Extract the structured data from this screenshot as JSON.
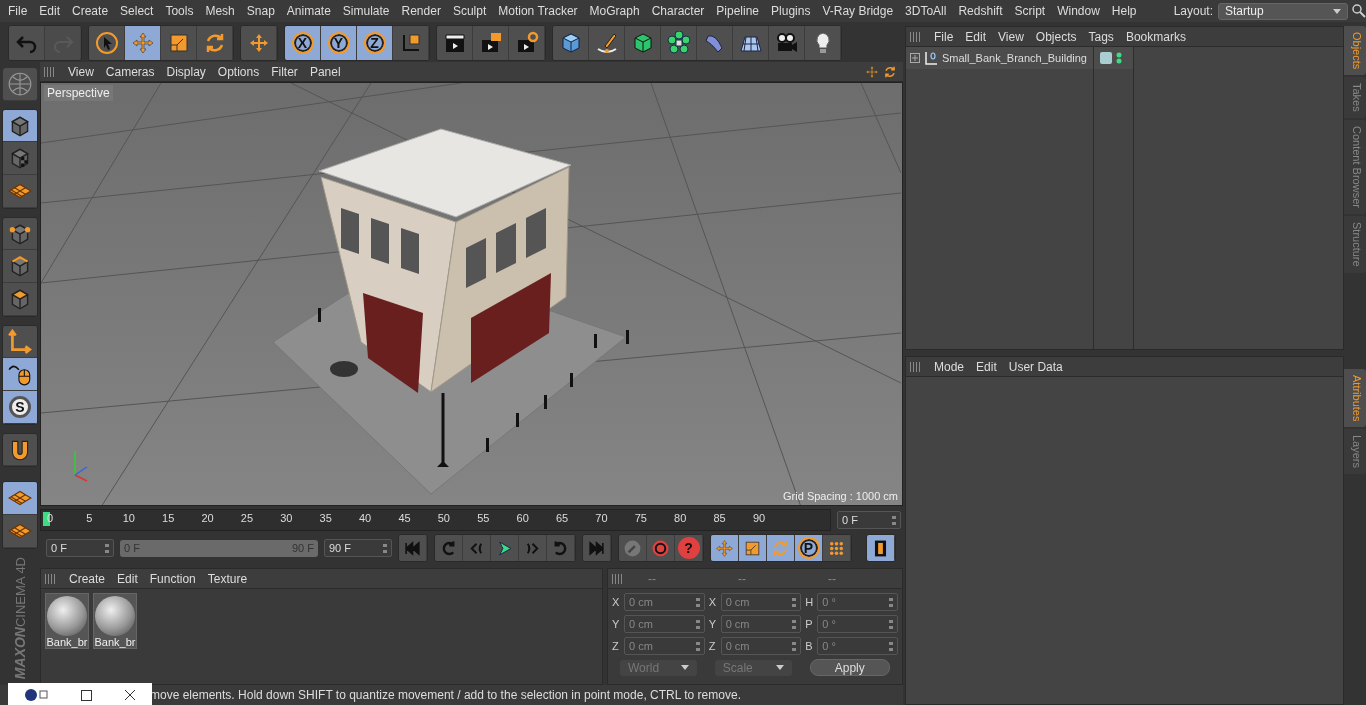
{
  "menu": [
    "File",
    "Edit",
    "Create",
    "Select",
    "Tools",
    "Mesh",
    "Snap",
    "Animate",
    "Simulate",
    "Render",
    "Sculpt",
    "Motion Tracker",
    "MoGraph",
    "Character",
    "Pipeline",
    "Plugins",
    "V-Ray Bridge",
    "3DToAll",
    "Redshift",
    "Script",
    "Window",
    "Help"
  ],
  "layout": {
    "label": "Layout:",
    "value": "Startup"
  },
  "toolbar": [
    [
      {
        "kind": "undo",
        "selected": false,
        "disabled": false
      },
      {
        "kind": "redo",
        "selected": false,
        "disabled": true
      }
    ],
    [
      {
        "kind": "select",
        "selected": false,
        "disabled": false
      },
      {
        "kind": "move",
        "selected": true,
        "disabled": false
      },
      {
        "kind": "scale",
        "selected": false,
        "disabled": false
      },
      {
        "kind": "rotate",
        "selected": false,
        "disabled": false
      }
    ],
    [
      {
        "kind": "transform",
        "selected": false,
        "disabled": false
      }
    ],
    [
      {
        "kind": "axis-x",
        "label": "X",
        "selected": true,
        "disabled": false
      },
      {
        "kind": "axis-y",
        "label": "Y",
        "selected": true,
        "disabled": false
      },
      {
        "kind": "axis-z",
        "label": "Z",
        "selected": true,
        "disabled": false
      },
      {
        "kind": "coord",
        "selected": false,
        "disabled": false
      }
    ],
    [
      {
        "kind": "render-view",
        "selected": false,
        "disabled": false
      },
      {
        "kind": "render-picture",
        "selected": false,
        "disabled": false
      },
      {
        "kind": "render-settings",
        "selected": false,
        "disabled": false
      }
    ],
    [
      {
        "kind": "cube",
        "selected": false,
        "disabled": false
      },
      {
        "kind": "pen",
        "selected": false,
        "disabled": false
      },
      {
        "kind": "subdivide",
        "selected": false,
        "disabled": false
      },
      {
        "kind": "cloner",
        "selected": false,
        "disabled": false
      },
      {
        "kind": "deformer",
        "selected": false,
        "disabled": false
      },
      {
        "kind": "floor",
        "selected": false,
        "disabled": false
      },
      {
        "kind": "camera",
        "selected": false,
        "disabled": false
      },
      {
        "kind": "light",
        "selected": false,
        "disabled": false
      }
    ]
  ],
  "sidebar": [
    [
      {
        "kind": "model",
        "selected": true
      },
      {
        "kind": "texture",
        "selected": false
      },
      {
        "kind": "workplane",
        "selected": false
      }
    ],
    [
      {
        "kind": "points",
        "selected": false
      },
      {
        "kind": "edges",
        "selected": false
      },
      {
        "kind": "polygons",
        "selected": false
      }
    ],
    [
      {
        "kind": "axis-tool",
        "selected": false
      },
      {
        "kind": "tweak",
        "selected": true
      },
      {
        "kind": "solo",
        "label": "S",
        "selected": true
      }
    ],
    [
      {
        "kind": "magnet",
        "selected": false
      }
    ]
  ],
  "viewport": {
    "menu": [
      "View",
      "Cameras",
      "Display",
      "Options",
      "Filter",
      "Panel"
    ],
    "label": "Perspective",
    "grid_spacing": "Grid Spacing : 1000 cm"
  },
  "timeline": {
    "ticks": [
      "0",
      "5",
      "10",
      "15",
      "20",
      "25",
      "30",
      "35",
      "40",
      "45",
      "50",
      "55",
      "60",
      "65",
      "70",
      "75",
      "80",
      "85",
      "90"
    ],
    "level": 0,
    "current_frame": "0 F",
    "start": "0 F",
    "range_start": "0 F",
    "range_end": "90 F",
    "range": {
      "level": 1
    },
    "end": "90 F"
  },
  "transport": [
    [
      {
        "kind": "first",
        "selected": false
      }
    ],
    [
      {
        "kind": "prev-key",
        "selected": false
      },
      {
        "kind": "prev",
        "selected": false
      },
      {
        "kind": "play",
        "selected": false
      },
      {
        "kind": "next",
        "selected": false
      },
      {
        "kind": "next-key",
        "selected": false
      }
    ],
    [
      {
        "kind": "last",
        "selected": false
      }
    ],
    [
      {
        "kind": "record-off",
        "selected": false
      },
      {
        "kind": "record",
        "selected": false
      },
      {
        "kind": "help",
        "label": "?",
        "selected": false
      }
    ],
    [
      {
        "kind": "move",
        "selected": true
      },
      {
        "kind": "scale",
        "selected": true
      },
      {
        "kind": "rotate",
        "selected": true
      },
      {
        "kind": "param",
        "label": "P",
        "selected": true
      },
      {
        "kind": "dots",
        "selected": false
      }
    ],
    [
      {
        "kind": "film",
        "selected": true
      }
    ]
  ],
  "materials": {
    "menu": [
      "Create",
      "Edit",
      "Function",
      "Texture"
    ],
    "items": [
      {
        "name": "Bank_br"
      },
      {
        "name": "Bank_br"
      }
    ]
  },
  "coordinates": {
    "headers": [
      "--",
      "--",
      "--"
    ],
    "rows": [
      [
        {
          "axis": "X",
          "value": "0 cm"
        },
        {
          "axis": "X",
          "value": "0 cm"
        },
        {
          "axis": "H",
          "value": "0 °"
        }
      ],
      [
        {
          "axis": "Y",
          "value": "0 cm"
        },
        {
          "axis": "Y",
          "value": "0 cm"
        },
        {
          "axis": "P",
          "value": "0 °"
        }
      ],
      [
        {
          "axis": "Z",
          "value": "0 cm"
        },
        {
          "axis": "Z",
          "value": "0 cm"
        },
        {
          "axis": "B",
          "value": "0 °"
        }
      ]
    ],
    "modes": [
      "World",
      "Scale"
    ],
    "apply": "Apply"
  },
  "logo": {
    "brand": "MAXON",
    "product": "CINEMA 4D"
  },
  "objects": {
    "menu": [
      "File",
      "Edit",
      "View",
      "Objects",
      "Tags",
      "Bookmarks"
    ],
    "items": [
      {
        "name": "Small_Bank_Branch_Building"
      }
    ]
  },
  "attributes": {
    "menu": [
      "Mode",
      "Edit",
      "User Data"
    ]
  },
  "tabs_top": [
    {
      "label": "Objects",
      "selected": true
    },
    {
      "label": "Takes",
      "selected": false
    },
    {
      "label": "Content Browser",
      "selected": false
    },
    {
      "label": "Structure",
      "selected": false
    }
  ],
  "tabs_bottom": [
    {
      "label": "Attributes",
      "selected": true
    },
    {
      "label": "Layers",
      "selected": false
    }
  ],
  "status": "move elements. Hold down SHIFT to quantize movement / add to the selection in point mode, CTRL to remove."
}
